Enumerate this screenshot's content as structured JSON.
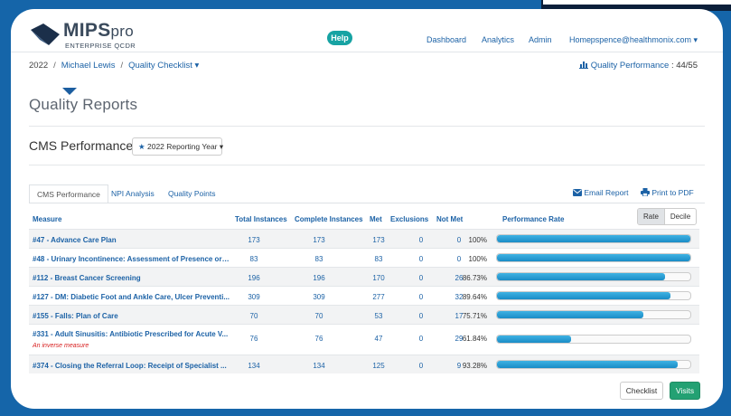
{
  "app": {
    "logo_text": "MIPS",
    "logo_text_suffix": "pro",
    "logo_subtitle": "ENTERPRISE QCDR"
  },
  "header": {
    "help_label": "Help",
    "nav": [
      "Dashboard",
      "Analytics",
      "Admin",
      "Home"
    ],
    "user": "pspence@healthmonix.com",
    "user_caret": "▾"
  },
  "breadcrumb": {
    "year": "2022",
    "separator": "/",
    "provider": "Michael Lewis",
    "page": "Quality Checklist",
    "page_caret": "▾"
  },
  "quality_performance": {
    "label": "Quality Performance",
    "separator": ":",
    "score": "44/55"
  },
  "page_title": "Quality Reports",
  "section": {
    "title": "CMS Performance",
    "year_star": "★",
    "year_label": "2022 Reporting Year",
    "year_caret": "▾"
  },
  "tabs": [
    {
      "label": "CMS Performance",
      "active": true
    },
    {
      "label": "NPI Analysis",
      "active": false
    },
    {
      "label": "Quality Points",
      "active": false
    }
  ],
  "actions": {
    "email": "Email Report",
    "pdf": "Print to PDF"
  },
  "table": {
    "columns": [
      "Measure",
      "Total Instances",
      "Complete Instances",
      "Met",
      "Exclusions",
      "Not Met",
      "Performance Rate"
    ],
    "toggle": {
      "rate": "Rate",
      "decile": "Decile",
      "selected": "Rate"
    },
    "rows": [
      {
        "measure": "#47 - Advance Care Plan",
        "total": "173",
        "complete": "173",
        "met": "173",
        "exclusions": "0",
        "not_met": "0",
        "rate": "100%",
        "rate_fraction": 1.0
      },
      {
        "measure": "#48 - Urinary Incontinence: Assessment of Presence or ...",
        "total": "83",
        "complete": "83",
        "met": "83",
        "exclusions": "0",
        "not_met": "0",
        "rate": "100%",
        "rate_fraction": 1.0
      },
      {
        "measure": "#112 - Breast Cancer Screening",
        "total": "196",
        "complete": "196",
        "met": "170",
        "exclusions": "0",
        "not_met": "26",
        "rate": "86.73%",
        "rate_fraction": 0.8673
      },
      {
        "measure": "#127 - DM: Diabetic Foot and Ankle Care, Ulcer Preventi...",
        "total": "309",
        "complete": "309",
        "met": "277",
        "exclusions": "0",
        "not_met": "32",
        "rate": "89.64%",
        "rate_fraction": 0.8964
      },
      {
        "measure": "#155 - Falls: Plan of Care",
        "total": "70",
        "complete": "70",
        "met": "53",
        "exclusions": "0",
        "not_met": "17",
        "rate": "75.71%",
        "rate_fraction": 0.7571
      },
      {
        "measure": "#331 - Adult Sinusitis: Antibiotic Prescribed for Acute V...",
        "note": "An inverse measure",
        "total": "76",
        "complete": "76",
        "met": "47",
        "exclusions": "0",
        "not_met": "29",
        "rate": "61.84%",
        "rate_fraction": 0.3816
      },
      {
        "measure": "#374 - Closing the Referral Loop: Receipt of Specialist ...",
        "total": "134",
        "complete": "134",
        "met": "125",
        "exclusions": "0",
        "not_met": "9",
        "rate": "93.28%",
        "rate_fraction": 0.9328
      }
    ]
  },
  "buttons": {
    "checklist": "Checklist",
    "visits": "Visits"
  },
  "colors": {
    "frame_bg": "#1565a9",
    "link": "#1c62a6",
    "help": "#17a3a3",
    "bar": "#2a9fd8",
    "visits": "#23a173",
    "inverse_note": "#d82020"
  }
}
